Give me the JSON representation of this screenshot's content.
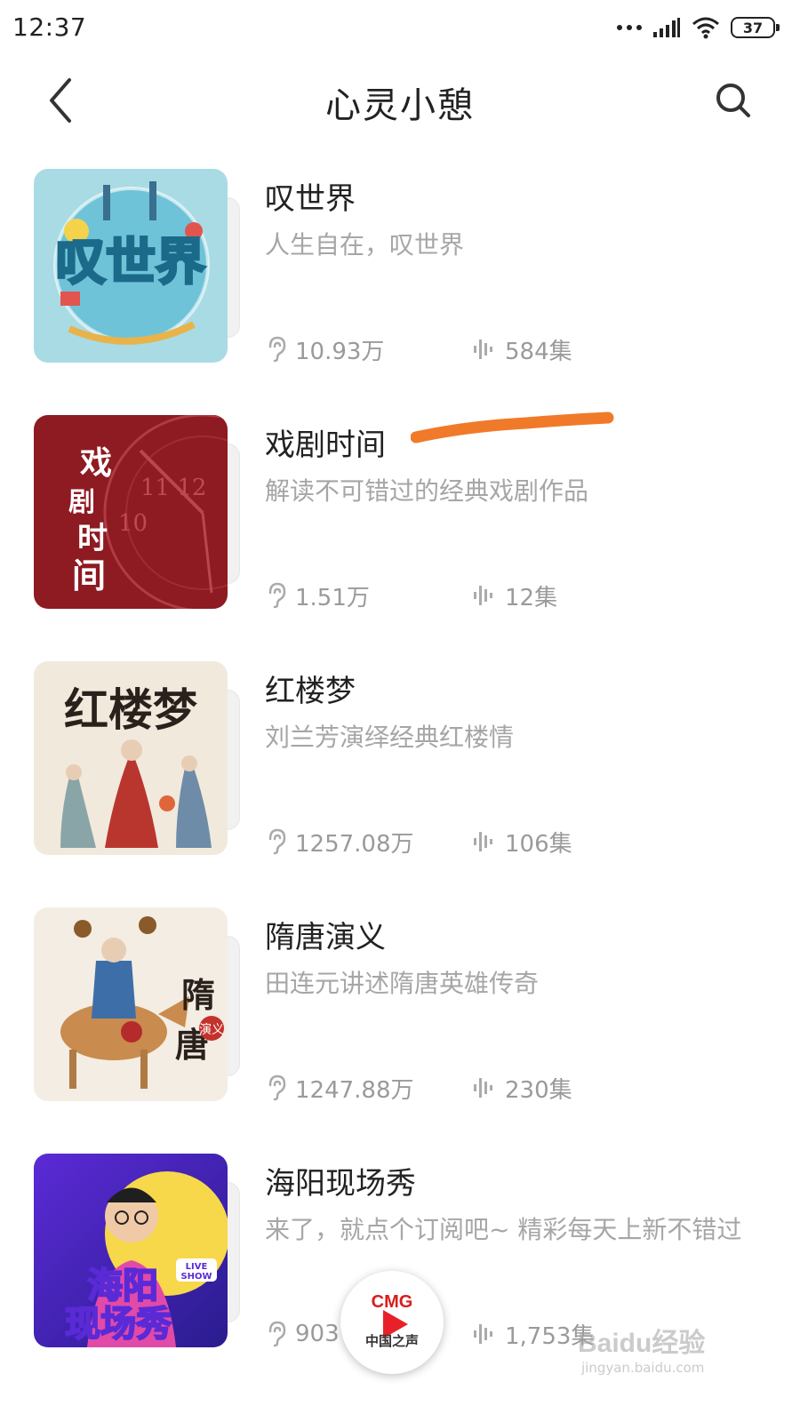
{
  "status_bar": {
    "time": "12:37",
    "battery": "37"
  },
  "header": {
    "title": "心灵小憩"
  },
  "items": [
    {
      "title": "叹世界",
      "desc": "人生自在，叹世界",
      "plays": "10.93万",
      "episodes": "584集",
      "cover_text": "叹世界"
    },
    {
      "title": "戏剧时间",
      "desc": "解读不可错过的经典戏剧作品",
      "plays": "1.51万",
      "episodes": "12集",
      "cover_text": "戏剧时间"
    },
    {
      "title": "红楼梦",
      "desc": "刘兰芳演绎经典红楼情",
      "plays": "1257.08万",
      "episodes": "106集",
      "cover_text": "红楼梦"
    },
    {
      "title": "隋唐演义",
      "desc": "田连元讲述隋唐英雄传奇",
      "plays": "1247.88万",
      "episodes": "230集",
      "cover_text": "隋唐演义"
    },
    {
      "title": "海阳现场秀",
      "desc": "来了，就点个订阅吧~ 精彩每天上新不错过",
      "plays": "903",
      "episodes": "1,753集",
      "cover_text": "海阳现场秀"
    }
  ],
  "mini_player": {
    "logo": "CMG",
    "sub": "中国之声"
  },
  "watermark": {
    "text": "Baidu经验",
    "sub": "jingyan.baidu.com"
  },
  "colors": {
    "accent_annotation": "#f07a2a",
    "muted_text": "#a6a6a6"
  }
}
